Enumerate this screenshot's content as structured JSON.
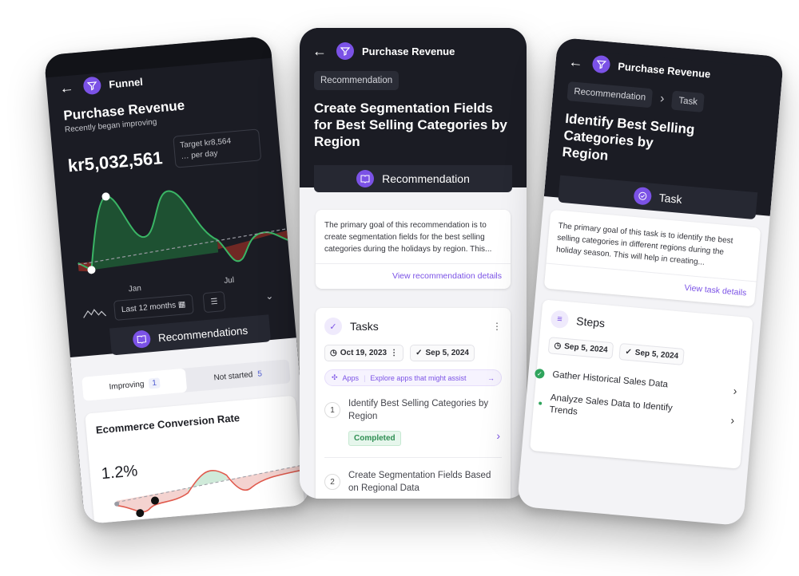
{
  "left": {
    "header_title": "Funnel",
    "metric_title": "Purchase Revenue",
    "metric_subtitle": "Recently began improving",
    "metric_value": "kr5,032,561",
    "target_line1": "Target kr8,564",
    "target_line2": "per day",
    "axis_jan": "Jan",
    "axis_jul": "Jul",
    "range_button": "Last 12 months",
    "recommendations_label": "Recommendations",
    "tab_improving": "Improving",
    "tab_improving_count": "1",
    "tab_not_started": "Not started",
    "tab_not_started_count": "5",
    "card_title": "Ecommerce Conversion Rate",
    "card_value": "1.2%"
  },
  "middle": {
    "header_title": "Purchase Revenue",
    "breadcrumb": "Recommendation",
    "title": "Create Segmentation Fields for Best Selling Categories by Region",
    "section_label": "Recommendation",
    "description": "The primary goal of this recommendation is to create segmentation fields for the best selling categories during the holidays by region. This...",
    "link": "View recommendation details",
    "tasks_title": "Tasks",
    "date_start": "Oct 19, 2023",
    "date_end": "Sep 5, 2024",
    "apps_label": "Apps",
    "apps_text": "Explore apps that might assist",
    "tasks": [
      {
        "num": "1",
        "label": "Identify Best Selling Categories by Region",
        "status": "Completed"
      },
      {
        "num": "2",
        "label": "Create Segmentation Fields Based on Regional Data"
      }
    ]
  },
  "right": {
    "header_title": "Purchase Revenue",
    "breadcrumb_1": "Recommendation",
    "breadcrumb_2": "Task",
    "title": "Identify Best Selling Categories by Region",
    "section_label": "Task",
    "description": "The primary goal of this task is to identify the best selling categories in different regions during the holiday season. This will help in creating...",
    "link": "View task details",
    "steps_title": "Steps",
    "date_start": "Sep 5, 2024",
    "date_end": "Sep 5, 2024",
    "steps": [
      {
        "label": "Gather Historical Sales Data"
      },
      {
        "label": "Analyze Sales Data to Identify Trends"
      }
    ]
  },
  "colors": {
    "accent": "#7b52e6",
    "positive": "#2fa45c",
    "negative": "#d9473b",
    "dark_bg": "#1b1c24"
  },
  "chart_data": [
    {
      "type": "area",
      "x": [
        "Jan",
        "Jul"
      ],
      "series": [],
      "legend": "none",
      "grid": false
    },
    {
      "type": "area",
      "series": [],
      "legend": "none",
      "grid": false
    }
  ]
}
